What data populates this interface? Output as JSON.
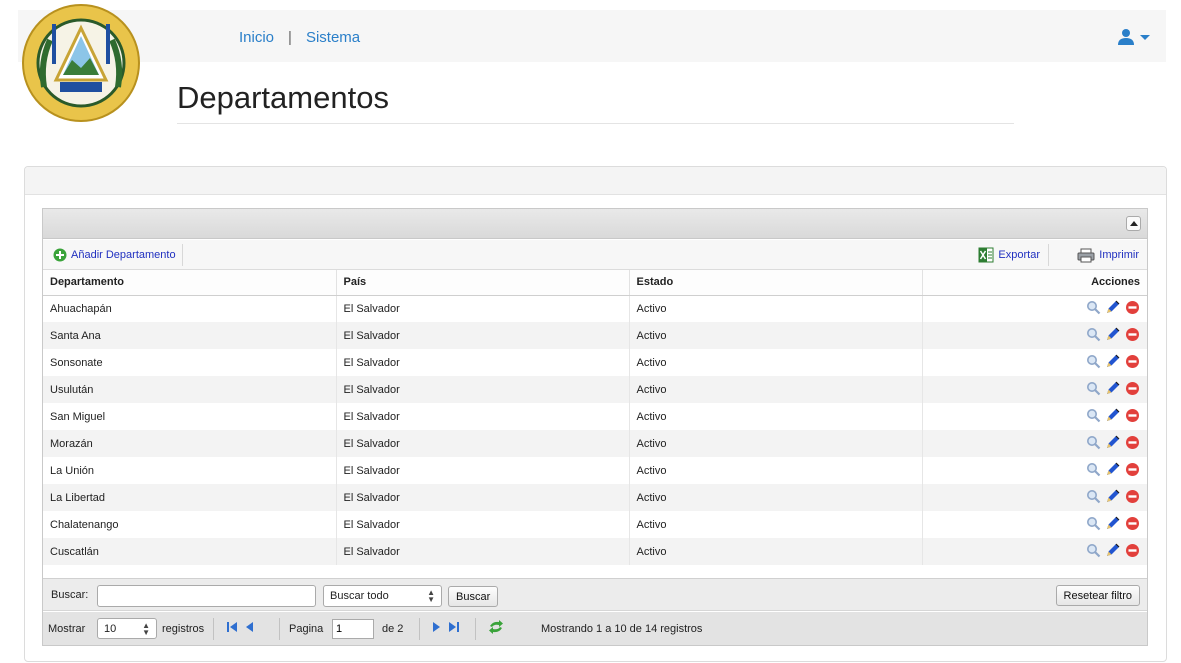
{
  "nav": {
    "home": "Inicio",
    "separator": "|",
    "system": "Sistema"
  },
  "page": {
    "title": "Departamentos"
  },
  "toolbar": {
    "add": "Añadir Departamento",
    "export": "Exportar",
    "print": "Imprimir"
  },
  "table": {
    "columns": [
      "Departamento",
      "País",
      "Estado",
      "Acciones"
    ],
    "rows": [
      [
        "Ahuachapán",
        "El Salvador",
        "Activo"
      ],
      [
        "Santa Ana",
        "El Salvador",
        "Activo"
      ],
      [
        "Sonsonate",
        "El Salvador",
        "Activo"
      ],
      [
        "Usulután",
        "El Salvador",
        "Activo"
      ],
      [
        "San Miguel",
        "El Salvador",
        "Activo"
      ],
      [
        "Morazán",
        "El Salvador",
        "Activo"
      ],
      [
        "La Unión",
        "El Salvador",
        "Activo"
      ],
      [
        "La Libertad",
        "El Salvador",
        "Activo"
      ],
      [
        "Chalatenango",
        "El Salvador",
        "Activo"
      ],
      [
        "Cuscatlán",
        "El Salvador",
        "Activo"
      ]
    ]
  },
  "search": {
    "label": "Buscar:",
    "value": "",
    "scope": "Buscar todo",
    "button": "Buscar",
    "reset": "Resetear filtro"
  },
  "pager": {
    "show_label": "Mostrar",
    "per_page": "10",
    "records_label": "registros",
    "page_label": "Pagina",
    "page_value": "1",
    "of_label": "de 2",
    "info": "Mostrando 1 a 10 de 14 registros"
  },
  "colors": {
    "link": "#2a7fc9",
    "add_icon": "#3aa33a",
    "edit_icon": "#2255d0",
    "delete_icon": "#e2403c",
    "view_icon": "#8fa7c9"
  },
  "icons": {
    "emblem": "el-salvador-coat-of-arms",
    "user": "user-icon",
    "add": "add-circle-icon",
    "export": "excel-icon",
    "print": "printer-icon",
    "view": "magnifier-icon",
    "edit": "pencil-icon",
    "delete": "delete-circle-icon",
    "refresh": "refresh-icon"
  }
}
